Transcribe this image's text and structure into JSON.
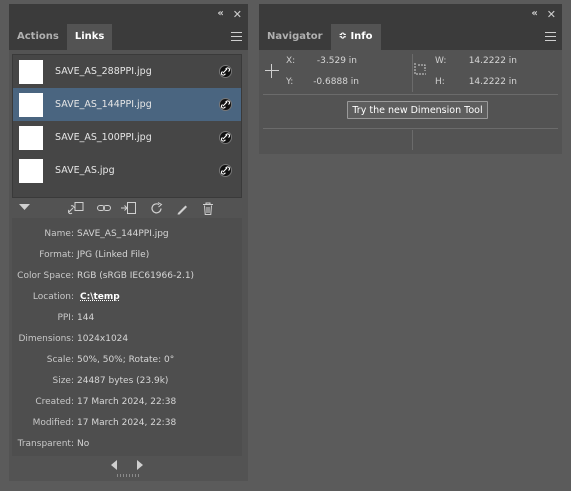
{
  "window_controls": {
    "collapse": "«",
    "close": "✕"
  },
  "links_panel": {
    "tabs": [
      {
        "label": "Actions",
        "active": false
      },
      {
        "label": "Links",
        "active": true
      }
    ],
    "files": [
      {
        "name": "SAVE_AS_288PPI.jpg",
        "selected": false
      },
      {
        "name": "SAVE_AS_144PPI.jpg",
        "selected": true
      },
      {
        "name": "SAVE_AS_100PPI.jpg",
        "selected": false
      },
      {
        "name": "SAVE_AS.jpg",
        "selected": false
      }
    ],
    "toolbar_icons": [
      "disclosure-triangle-icon",
      "relink-to-cc-icon",
      "relink-icon",
      "go-to-link-icon",
      "update-link-icon",
      "edit-original-icon",
      "trash-icon"
    ],
    "info": {
      "name": {
        "label": "Name:",
        "value": "SAVE_AS_144PPI.jpg"
      },
      "format": {
        "label": "Format:",
        "value": "JPG (Linked File)"
      },
      "color_space": {
        "label": "Color Space:",
        "value": "RGB (sRGB IEC61966-2.1)"
      },
      "location": {
        "label": "Location:",
        "value": "C:\\temp"
      },
      "ppi": {
        "label": "PPI:",
        "value": "144"
      },
      "dimensions": {
        "label": "Dimensions:",
        "value": "1024x1024"
      },
      "scale": {
        "label": "Scale:",
        "value": "50%, 50%; Rotate: 0°"
      },
      "size": {
        "label": "Size:",
        "value": "24487 bytes (23.9k)"
      },
      "created": {
        "label": "Created:",
        "value": "17 March 2024, 22:38"
      },
      "modified": {
        "label": "Modified:",
        "value": "17 March 2024, 22:38"
      },
      "transparent": {
        "label": "Transparent:",
        "value": "No"
      }
    }
  },
  "info_panel": {
    "tabs": [
      {
        "label": "Navigator",
        "active": false
      },
      {
        "label": "Info",
        "active": true,
        "prefix": "≎"
      }
    ],
    "x_label": "X:",
    "x_value": "-3.529 in",
    "y_label": "Y:",
    "y_value": "-0.6888 in",
    "w_label": "W:",
    "w_value": "14.2222 in",
    "h_label": "H:",
    "h_value": "14.2222 in",
    "button_label": "Try the new Dimension Tool"
  }
}
